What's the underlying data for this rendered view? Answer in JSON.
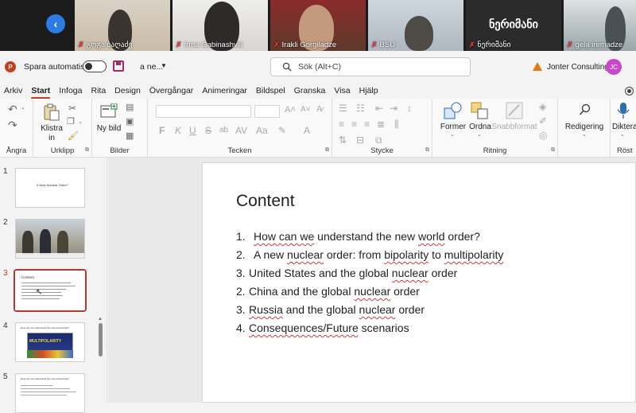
{
  "video": {
    "participants": [
      {
        "name": "გოგა ბაღაძე"
      },
      {
        "name": "Irma Gabinashvili"
      },
      {
        "name": "Irakli Gorgiladze"
      },
      {
        "name": "BSU"
      },
      {
        "name": "ნერიმანი",
        "big_label": "ნერიმანი"
      },
      {
        "name": "gela iremadze"
      }
    ]
  },
  "titlebar": {
    "autosave_label": "Spara automatiskt",
    "doc_name": "a ne...",
    "search_placeholder": "Sök (Alt+C)",
    "org": "Jonter Consulting",
    "avatar_initials": "JC"
  },
  "tabs": [
    "Arkiv",
    "Start",
    "Infoga",
    "Rita",
    "Design",
    "Övergångar",
    "Animeringar",
    "Bildspel",
    "Granska",
    "Visa",
    "Hjälp"
  ],
  "ribbon": {
    "groups": {
      "undo": "Ångra",
      "clipboard": "Urklipp",
      "slides": "Bilder",
      "font": "Tecken",
      "paragraph": "Stycke",
      "drawing": "Ritning",
      "voice": "Röst"
    },
    "buttons": {
      "paste": "Klistra in",
      "new_slide": "Ny bild",
      "shapes": "Former",
      "arrange": "Ordna",
      "quick_styles": "Snabbformat",
      "editing": "Redigering",
      "dictate": "Diktera"
    },
    "font_buttons": [
      "F",
      "K",
      "U",
      "S",
      "ab"
    ]
  },
  "thumbnails": [
    {
      "num": "1",
      "title": "A New Nuclear Order?"
    },
    {
      "num": "2"
    },
    {
      "num": "3",
      "title": "Content"
    },
    {
      "num": "4",
      "title": "How can we understand the new world order?",
      "banner": "MULTIPOLARITY"
    },
    {
      "num": "5",
      "title": "How can we understand the new world order?"
    }
  ],
  "slide": {
    "title": "Content",
    "items": [
      {
        "num": "1.",
        "parts": [
          {
            "t": "How can we",
            "sq": true
          },
          {
            "t": " understand the new "
          },
          {
            "t": "world",
            "sq": true
          },
          {
            "t": " order?"
          }
        ]
      },
      {
        "num": "2.",
        "parts": [
          {
            "t": "A new "
          },
          {
            "t": "nuclear",
            "sq": true
          },
          {
            "t": " order: from "
          },
          {
            "t": "bipolarity",
            "sq": true
          },
          {
            "t": " to "
          },
          {
            "t": "multipolarity",
            "sq": true
          }
        ]
      },
      {
        "num": "3.",
        "parts": [
          {
            "t": "United States and the global "
          },
          {
            "t": "nuclear",
            "sq": true
          },
          {
            "t": " order"
          }
        ]
      },
      {
        "num": "2.",
        "parts": [
          {
            "t": "China and the global "
          },
          {
            "t": "nuclear",
            "sq": true
          },
          {
            "t": " order"
          }
        ]
      },
      {
        "num": "3.",
        "parts": [
          {
            "t": "Russia",
            "sq": true
          },
          {
            "t": " and the global "
          },
          {
            "t": "nuclear",
            "sq": true
          },
          {
            "t": " order"
          }
        ]
      },
      {
        "num": "4.",
        "parts": [
          {
            "t": "Consequences/Future",
            "sq": true
          },
          {
            "t": " scenarios"
          }
        ]
      }
    ]
  },
  "colors": {
    "accent": "#c43e1c",
    "selection": "#b03a2e",
    "spellcheck": "#d23a3a"
  }
}
